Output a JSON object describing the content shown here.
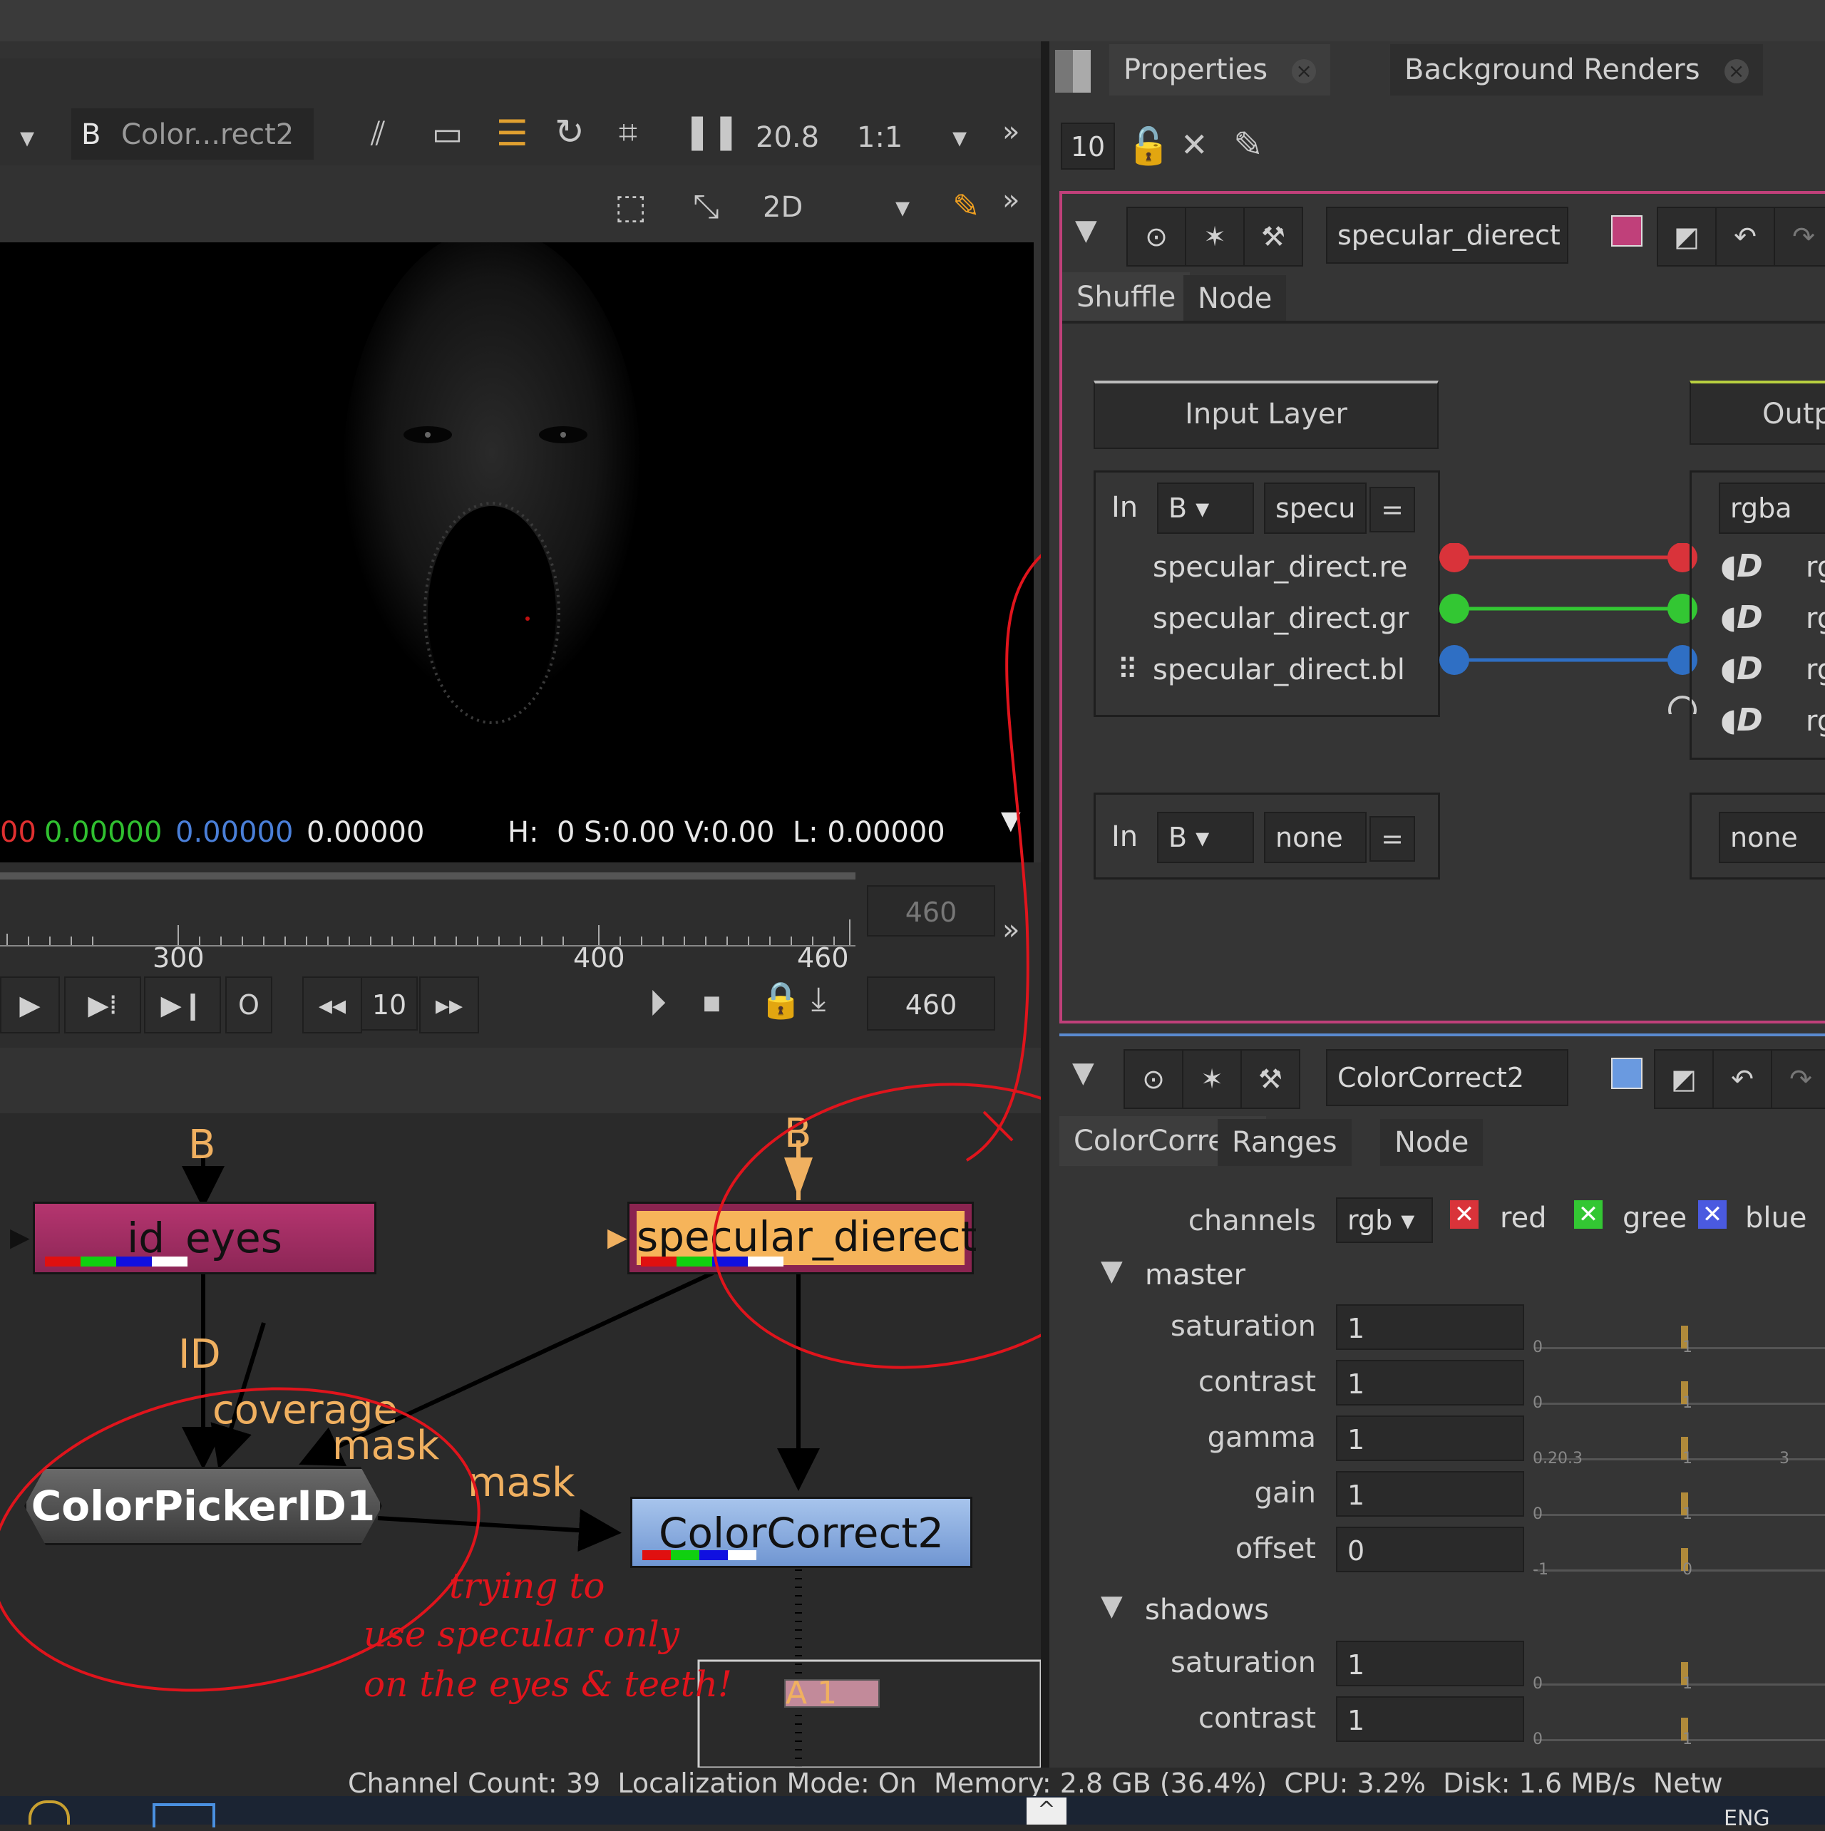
{
  "viewer": {
    "input_b_label": "B",
    "input_name": "Color...rect2",
    "zoom": "20.8",
    "ratio": "1:1",
    "view_mode": "2D",
    "pixel_r": "00",
    "pixel_g": "0.00000",
    "pixel_b": "0.00000",
    "pixel_a": "0.00000",
    "hsv": "H:  0 S:0.00 V:0.00  L: 0.00000"
  },
  "timeline": {
    "ticks": [
      "300",
      "400",
      "460"
    ],
    "end_frame_top": "460",
    "end_frame_bottom": "460",
    "step": "10",
    "o_button": "O"
  },
  "nodes": {
    "input_b_1": "B",
    "input_b_2": "B",
    "id_eyes": "id_eyes",
    "specular": "specular_dierect",
    "colorpicker": "ColorPickerID1",
    "colorcorrect": "ColorCorrect2",
    "edge_id": "ID",
    "edge_coverage": "coverage",
    "edge_mask1": "mask",
    "edge_mask2": "mask",
    "backdrop": "A 1"
  },
  "annotations": {
    "note_line1": "trying to",
    "note_line2": "use specular only",
    "note_line3": "on the eyes & teeth!"
  },
  "properties": {
    "tab_properties": "Properties",
    "tab_bg_renders": "Background Renders",
    "max_panels": "10",
    "shuffle": {
      "name": "specular_dierect",
      "tab_shuffle": "Shuffle",
      "tab_node": "Node",
      "input_layer": "Input Layer",
      "output_layer": "Outp",
      "in_label": "In",
      "in_b": "B",
      "in_layer": "specu",
      "eq": "=",
      "channels": [
        "specular_direct.re",
        "specular_direct.gr",
        "specular_direct.bl"
      ],
      "out_layer": "rgba",
      "out_ch": "rg",
      "in2_label": "In",
      "in2_b": "B",
      "in2_layer": "none",
      "out2_layer": "none",
      "channel_colors": [
        "#d9333a",
        "#33c733",
        "#2f6fc4"
      ]
    },
    "colorcorrect": {
      "name": "ColorCorrect2",
      "tab_cc": "ColorCorrect",
      "tab_ranges": "Ranges",
      "tab_node": "Node",
      "channels_label": "channels",
      "channels_value": "rgb",
      "ch_red": "red",
      "ch_green": "gree",
      "ch_blue": "blue",
      "master": "master",
      "shadows": "shadows",
      "master_rows": [
        {
          "label": "saturation",
          "value": "1",
          "scale": "0",
          "scale2": "1"
        },
        {
          "label": "contrast",
          "value": "1",
          "scale": "0",
          "scale2": "1"
        },
        {
          "label": "gamma",
          "value": "1",
          "scale": "0.20.3",
          "scale2": "1",
          "scale3": "3"
        },
        {
          "label": "gain",
          "value": "1",
          "scale": "0",
          "scale2": "1"
        },
        {
          "label": "offset",
          "value": "0",
          "scale": "-1",
          "scale2": "0"
        }
      ],
      "shadow_rows": [
        {
          "label": "saturation",
          "value": "1",
          "scale": "0",
          "scale2": "1"
        },
        {
          "label": "contrast",
          "value": "1",
          "scale": "0",
          "scale2": "1"
        }
      ]
    }
  },
  "statusbar": {
    "text": "Channel Count: 39  Localization Mode: On  Memory: 2.8 GB (36.4%)  CPU: 3.2%  Disk: 1.6 MB/s  Netw",
    "lang": "ENG"
  }
}
